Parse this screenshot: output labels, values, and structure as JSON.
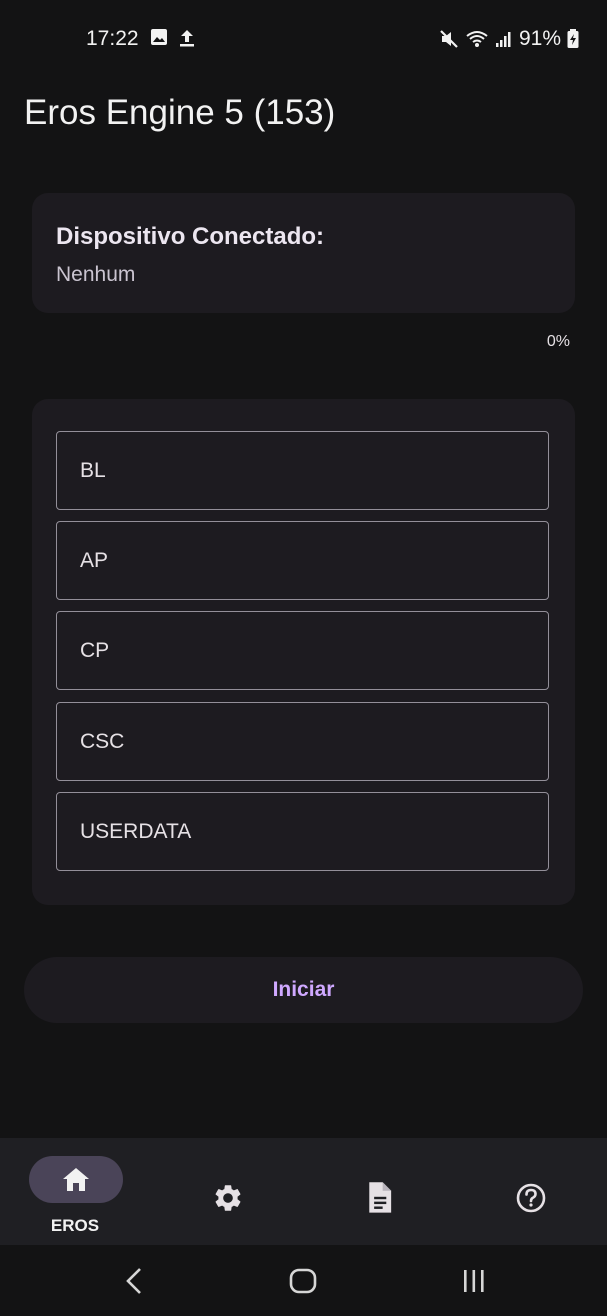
{
  "status_bar": {
    "time": "17:22",
    "battery": "91%",
    "icons": [
      "image-icon",
      "upload-icon",
      "mute-icon",
      "wifi-icon",
      "signal-icon",
      "battery-icon"
    ]
  },
  "app": {
    "title": "Eros Engine 5 (153)"
  },
  "device": {
    "label": "Dispositivo Conectado:",
    "value": "Nenhum"
  },
  "progress": {
    "percent_text": "0%",
    "value": 0
  },
  "partitions": [
    {
      "label": "BL"
    },
    {
      "label": "AP"
    },
    {
      "label": "CP"
    },
    {
      "label": "CSC"
    },
    {
      "label": "USERDATA"
    }
  ],
  "start_button": {
    "label": "Iniciar"
  },
  "bottom_nav": {
    "items": [
      {
        "label": "EROS",
        "icon": "home-icon",
        "selected": true
      },
      {
        "label": "",
        "icon": "settings-icon",
        "selected": false
      },
      {
        "label": "",
        "icon": "document-icon",
        "selected": false
      },
      {
        "label": "",
        "icon": "help-icon",
        "selected": false
      }
    ]
  },
  "system_nav": {
    "icons": [
      "back-icon",
      "home-circle-icon",
      "recents-icon"
    ]
  },
  "colors": {
    "background": "#131314",
    "card": "#1d1b20",
    "accent": "#cfa8ff",
    "nav_indicator": "#4a4458"
  }
}
